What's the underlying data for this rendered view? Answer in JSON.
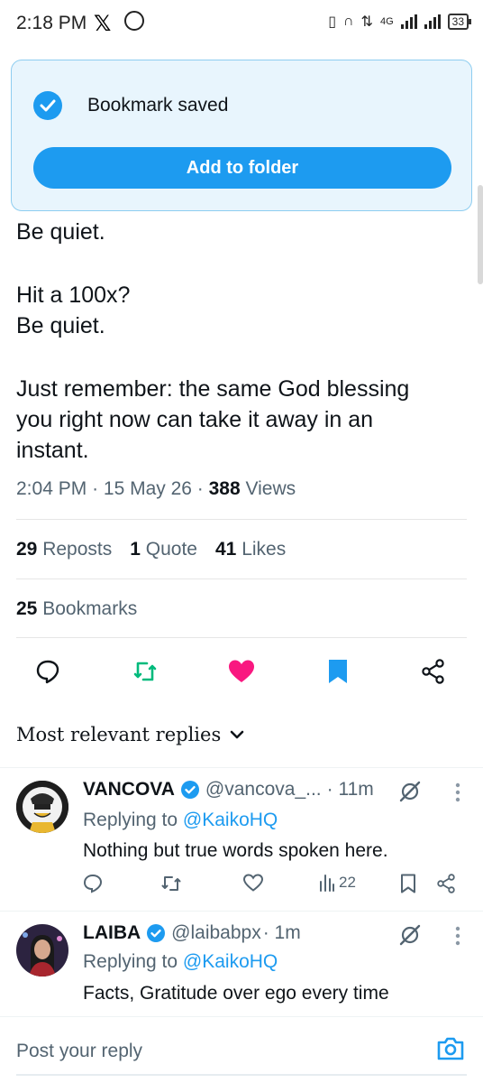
{
  "status_bar": {
    "time": "2:18 PM",
    "network": "4G",
    "battery": "33"
  },
  "tweet": {
    "paragraphs": [
      "Be quiet.",
      "Hit a 100x?",
      "Be quiet.",
      "Just remember: the same God blessing",
      "you right now can take it away in an",
      "instant."
    ],
    "time": "2:04 PM",
    "date": "15 May 26",
    "views_count": "388",
    "views_label": "Views",
    "reposts_count": "29",
    "reposts_label": "Reposts",
    "quotes_count": "1",
    "quotes_label": "Quote",
    "likes_count": "41",
    "likes_label": "Likes",
    "bookmarks_count": "25",
    "bookmarks_label": "Bookmarks"
  },
  "sort": {
    "label": "Most relevant replies"
  },
  "replies": [
    {
      "name": "VANCOVA",
      "handle": "@vancova_...",
      "time": "· 11m",
      "replying_prefix": "Replying to",
      "replying_to": "@KaikoHQ",
      "text": "Nothing but true words spoken here.",
      "views": "22"
    },
    {
      "name": "LAIBA",
      "handle": "@laibabpx",
      "time": "· 1m",
      "replying_prefix": "Replying to",
      "replying_to": "@KaikoHQ",
      "text": "Facts, Gratitude over ego every time"
    }
  ],
  "composer": {
    "placeholder": "Post your reply"
  },
  "toast": {
    "message": "Bookmark saved",
    "button": "Add to folder"
  },
  "colors": {
    "accent": "#1d9bf0",
    "like": "#f91880",
    "repost": "#00ba7c",
    "secondary_text": "#536471"
  }
}
